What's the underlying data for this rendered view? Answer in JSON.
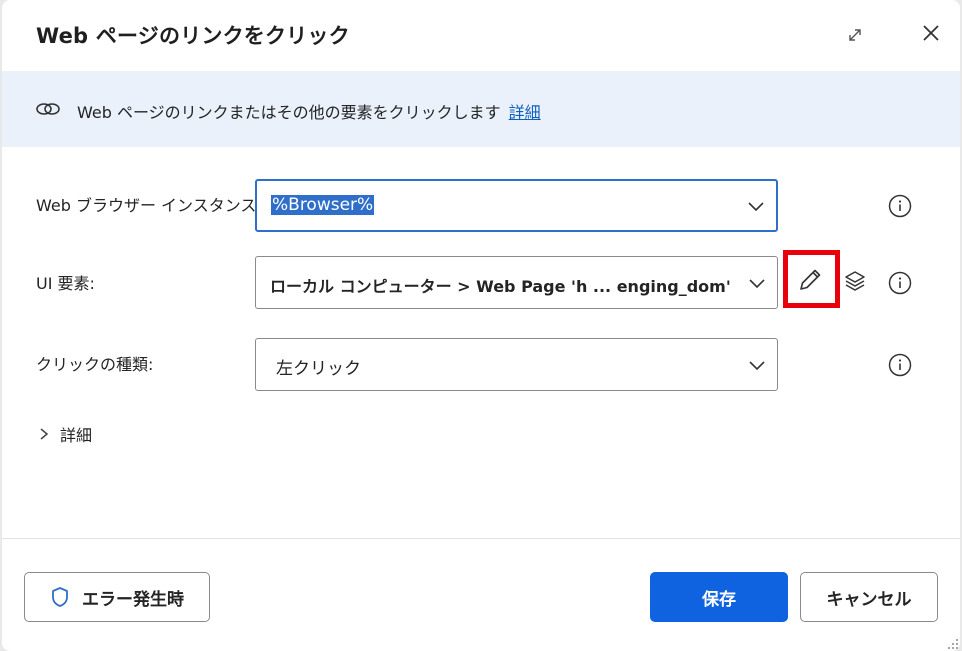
{
  "dialog": {
    "title": "Web ページのリンクをクリック",
    "expand_icon": "expand-icon",
    "close_icon": "close-icon"
  },
  "banner": {
    "icon": "link-icon",
    "text": "Web ページのリンクまたはその他の要素をクリックします",
    "link": "詳細"
  },
  "fields": {
    "browser": {
      "label": "Web ブラウザー インスタンス:",
      "value": "%Browser%"
    },
    "ui_element": {
      "label": "UI 要素:",
      "value": "ローカル コンピューター > Web Page 'h ... enging_dom' > An"
    },
    "click_type": {
      "label": "クリックの種類:",
      "value": "左クリック"
    }
  },
  "details": {
    "label": "詳細"
  },
  "buttons": {
    "on_error": "エラー発生時",
    "save": "保存",
    "cancel": "キャンセル"
  },
  "colors": {
    "primary": "#0f62e0",
    "banner_bg": "#eaf1fb",
    "highlight": "#e8000b",
    "link": "#0f5fbf"
  }
}
